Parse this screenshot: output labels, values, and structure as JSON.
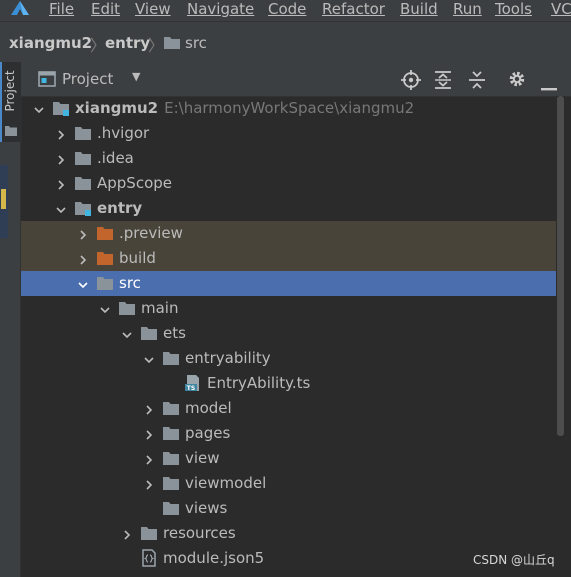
{
  "menubar": {
    "items": [
      "File",
      "Edit",
      "View",
      "Navigate",
      "Code",
      "Refactor",
      "Build",
      "Run",
      "Tools",
      "VC"
    ]
  },
  "breadcrumb": {
    "items": [
      "xiangmu2",
      "entry",
      "src"
    ]
  },
  "sidebar": {
    "tab_label": "Project"
  },
  "panel": {
    "title": "Project",
    "toolbar_icons": [
      "locate-icon",
      "expand-all-icon",
      "collapse-all-icon",
      "gear-icon",
      "minimize-icon"
    ]
  },
  "tree": {
    "rows": [
      {
        "label": "xiangmu2",
        "path": "E:\\harmonyWorkSpace\\xiangmu2",
        "icon": "module-folder-icon",
        "state": "expanded"
      },
      {
        "label": ".hvigor",
        "icon": "folder-icon",
        "state": "collapsed"
      },
      {
        "label": ".idea",
        "icon": "folder-icon",
        "state": "collapsed"
      },
      {
        "label": "AppScope",
        "icon": "folder-icon",
        "state": "collapsed"
      },
      {
        "label": "entry",
        "icon": "module-folder-icon",
        "state": "expanded"
      },
      {
        "label": ".preview",
        "icon": "excluded-folder-icon",
        "state": "collapsed"
      },
      {
        "label": "build",
        "icon": "excluded-folder-icon",
        "state": "collapsed"
      },
      {
        "label": "src",
        "icon": "folder-icon",
        "state": "expanded",
        "selected": true
      },
      {
        "label": "main",
        "icon": "folder-icon",
        "state": "expanded"
      },
      {
        "label": "ets",
        "icon": "folder-icon",
        "state": "expanded"
      },
      {
        "label": "entryability",
        "icon": "folder-icon",
        "state": "expanded"
      },
      {
        "label": "EntryAbility.ts",
        "icon": "ts-file-icon",
        "badge": "TS"
      },
      {
        "label": "model",
        "icon": "folder-icon",
        "state": "collapsed"
      },
      {
        "label": "pages",
        "icon": "folder-icon",
        "state": "collapsed"
      },
      {
        "label": "view",
        "icon": "folder-icon",
        "state": "collapsed"
      },
      {
        "label": "viewmodel",
        "icon": "folder-icon",
        "state": "collapsed"
      },
      {
        "label": "views",
        "icon": "folder-icon"
      },
      {
        "label": "resources",
        "icon": "folder-icon",
        "state": "collapsed"
      },
      {
        "label": "module.json5",
        "icon": "json-file-icon"
      }
    ]
  },
  "watermark": "CSDN @山丘q",
  "colors": {
    "background": "#2b2b2b",
    "chrome": "#3c3f41",
    "selection": "#4b6eaf",
    "excluded_row": "#49443a",
    "folder": "#8a9399",
    "excluded_folder": "#c2652d",
    "module_badge": "#40b6e0"
  }
}
